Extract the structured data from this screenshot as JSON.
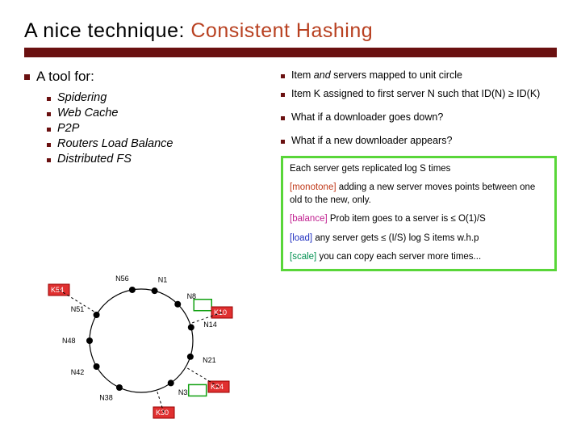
{
  "title_plain": "A nice technique: ",
  "title_accent": "Consistent Hashing",
  "left_heading": "A tool for:",
  "left_items": [
    "Spidering",
    "Web Cache",
    "P2P",
    "Routers Load Balance",
    "Distributed FS"
  ],
  "right_items": [
    {
      "pre": "Item ",
      "it": "and",
      "post": " servers mapped to unit circle"
    },
    {
      "pre": "Item K assigned to first server N such that ID(N) ≥ ID(K)",
      "it": "",
      "post": ""
    },
    {
      "pre": "What if a downloader goes down?",
      "it": "",
      "post": ""
    },
    {
      "pre": "What if a new downloader appears?",
      "it": "",
      "post": ""
    }
  ],
  "box_lead": "Each server gets replicated log S times",
  "box_props": [
    {
      "tag": "[monotone]",
      "cls": "tag-mono",
      "text": " adding a new server moves points between one old to the new, only."
    },
    {
      "tag": "[balance]",
      "cls": "tag-bal",
      "text": " Prob item goes to a server is ≤ O(1)/S"
    },
    {
      "tag": "[load]",
      "cls": "tag-load",
      "text": " any server gets  ≤  (I/S) log S items w.h.p"
    },
    {
      "tag": "[scale]",
      "cls": "tag-scale",
      "text": " you can copy each server more times..."
    }
  ],
  "ring_nodes": [
    "N56",
    "N1",
    "N8",
    "N14",
    "N21",
    "N32",
    "N38",
    "N42",
    "N48",
    "N51"
  ],
  "ring_keys": [
    "K54",
    "K10",
    "K24",
    "K30"
  ]
}
